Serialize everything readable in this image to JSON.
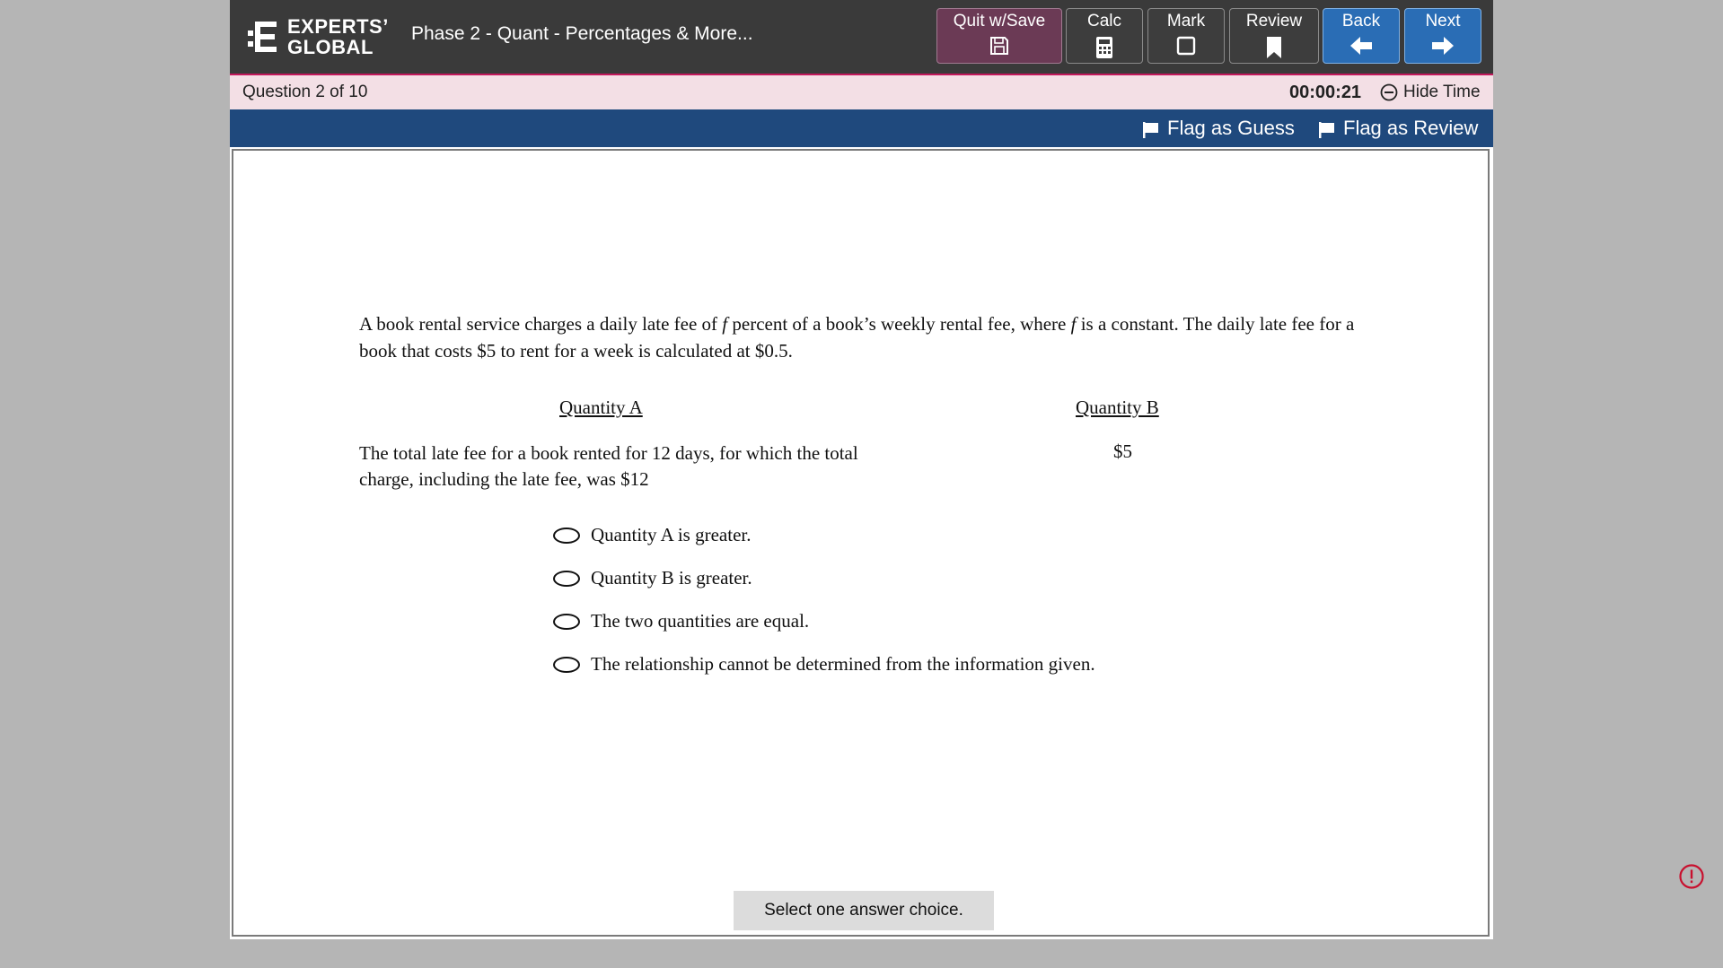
{
  "header": {
    "logo_line1": "EXPERTS’",
    "logo_line2": "GLOBAL",
    "title": "Phase 2 - Quant - Percentages & More...",
    "buttons": {
      "quit": "Quit w/Save",
      "calc": "Calc",
      "mark": "Mark",
      "review": "Review",
      "back": "Back",
      "next": "Next"
    }
  },
  "infobar": {
    "question_count": "Question 2 of 10",
    "timer": "00:00:21",
    "hide_time": "Hide Time"
  },
  "flags": {
    "guess": "Flag as Guess",
    "review": "Flag as Review"
  },
  "question": {
    "stem_part1": "A book rental service charges a daily late fee of ",
    "var1": "f",
    "stem_part2": " percent of a book’s weekly rental fee, where ",
    "var2": "f",
    "stem_part3": " is a constant. The daily late fee for a book that costs $5 to rent for a week is calculated at $0.5.",
    "quantity_a_label": "Quantity A",
    "quantity_b_label": "Quantity B",
    "quantity_a_text": "The total late fee for a book rented for 12 days, for which the total charge, including the late fee, was $12",
    "quantity_b_text": "$5",
    "choices": [
      "Quantity A is greater.",
      "Quantity B is greater.",
      "The two quantities are equal.",
      "The relationship cannot be determined from the information given."
    ]
  },
  "footer": {
    "hint": "Select one answer choice."
  },
  "colors": {
    "header_bg": "#3a3a3a",
    "accent_pink": "#c2185b",
    "info_bg": "#f3dfe5",
    "flag_bar": "#1f497d",
    "nav_blue": "#2a6db5",
    "quit_bg": "#6b3a55"
  },
  "icons": [
    "logo-mark-icon",
    "save-icon",
    "calculator-icon",
    "checkbox-icon",
    "bookmark-icon",
    "arrow-left-icon",
    "arrow-right-icon",
    "minus-circle-icon",
    "flag-icon",
    "alert-circle-icon"
  ]
}
